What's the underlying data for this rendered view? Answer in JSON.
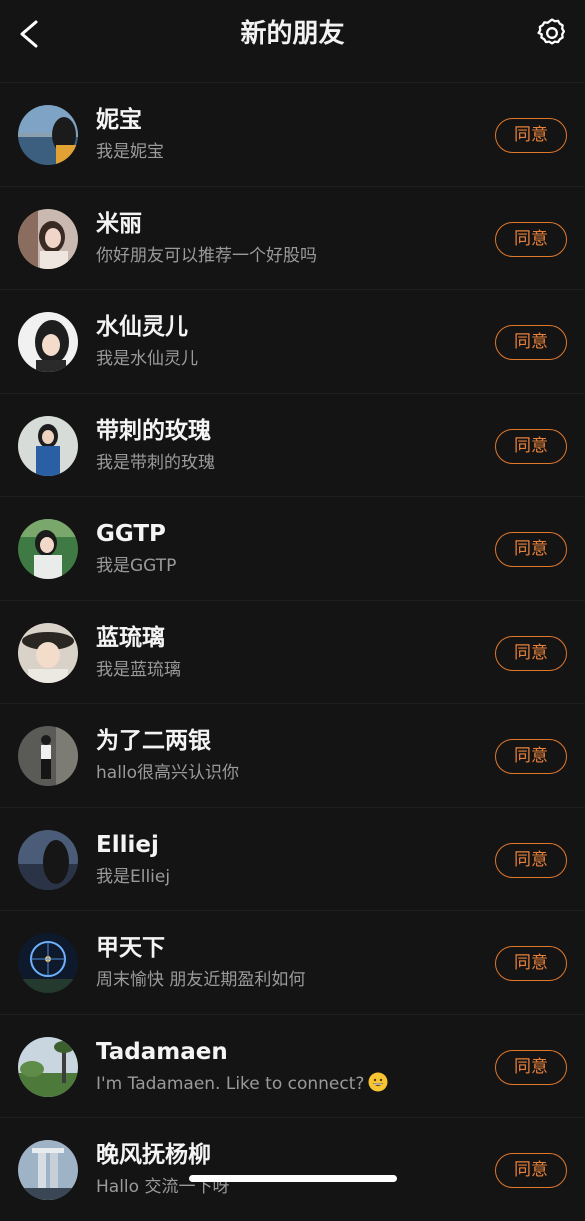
{
  "header": {
    "title": "新的朋友",
    "back_icon": "chevron-left-icon",
    "settings_icon": "gear-icon"
  },
  "requests": [
    {
      "name": "妮宝",
      "message": "我是妮宝",
      "action": "同意"
    },
    {
      "name": "米丽",
      "message": "你好朋友可以推荐一个好股吗",
      "action": "同意"
    },
    {
      "name": "水仙灵儿",
      "message": "我是水仙灵儿",
      "action": "同意"
    },
    {
      "name": "带刺的玫瑰",
      "message": "我是带刺的玫瑰",
      "action": "同意"
    },
    {
      "name": "GGTP",
      "message": "我是GGTP",
      "action": "同意"
    },
    {
      "name": "蓝琉璃",
      "message": "我是蓝琉璃",
      "action": "同意"
    },
    {
      "name": "为了二两银",
      "message": "hallo很高兴认识你",
      "action": "同意"
    },
    {
      "name": "Elliej",
      "message": "我是Elliej",
      "action": "同意"
    },
    {
      "name": "甲天下",
      "message": "周末愉快 朋友近期盈利如何",
      "action": "同意"
    },
    {
      "name": "Tadamaen",
      "message": "I'm Tadamaen. Like to connect?",
      "message_icon": "grinning-emoji-icon",
      "action": "同意"
    },
    {
      "name": "晚风抚杨柳",
      "message": "Hallo 交流一下呀",
      "action": "同意"
    }
  ],
  "colors": {
    "background": "#141414",
    "accent": "#e0782b",
    "subtext": "#9a9a9a"
  }
}
